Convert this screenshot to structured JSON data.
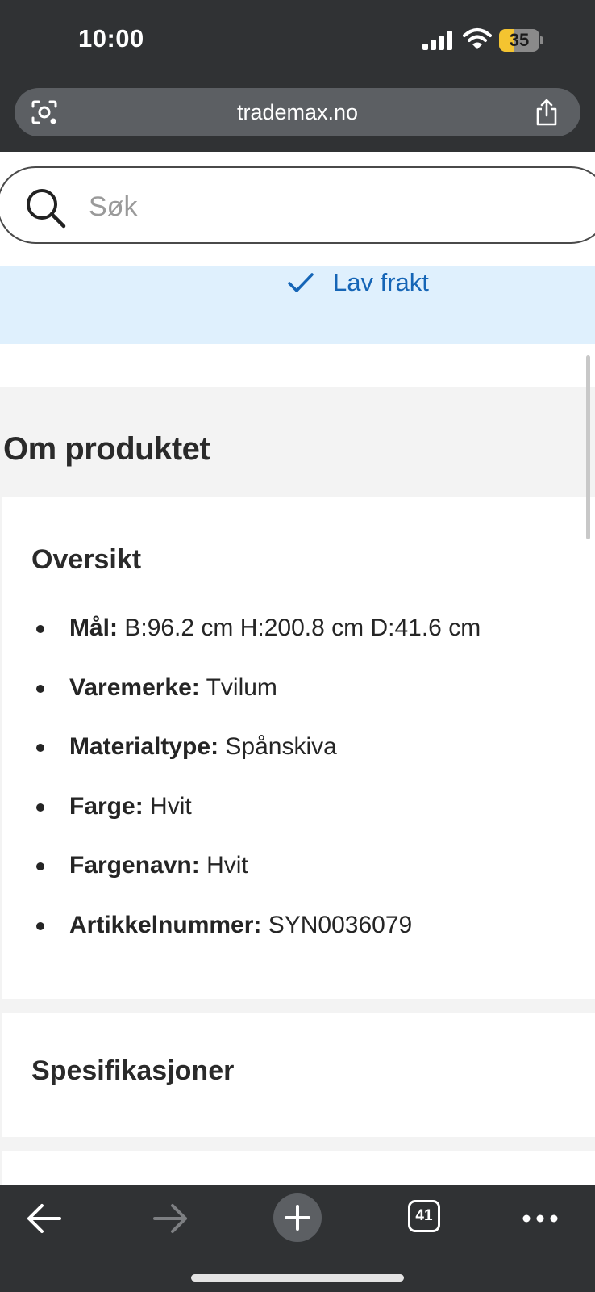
{
  "status_bar": {
    "time": "10:00",
    "battery": "35",
    "battery_fraction": 0.35,
    "icons": [
      "signal-icon",
      "wifi-icon",
      "battery-icon"
    ]
  },
  "browser": {
    "url": "trademax.no",
    "tab_count": "41",
    "icons": [
      "lens-icon",
      "share-icon",
      "back-arrow-icon",
      "forward-arrow-icon",
      "plus-icon",
      "tabs-icon",
      "more-icon"
    ]
  },
  "search": {
    "placeholder": "Søk",
    "value": ""
  },
  "banner": {
    "text": "Lav frakt",
    "icon": "check-icon",
    "color": "#1565b6",
    "background": "#dff0fd"
  },
  "product": {
    "section_title": "Om produktet",
    "overview": {
      "title": "Oversikt",
      "items": [
        {
          "label": "Mål:",
          "value": "B:96.2 cm H:200.8 cm D:41.6 cm"
        },
        {
          "label": "Varemerke:",
          "value": "Tvilum"
        },
        {
          "label": "Materialtype:",
          "value": "Spånskiva"
        },
        {
          "label": "Farge:",
          "value": "Hvit"
        },
        {
          "label": "Fargenavn:",
          "value": "Hvit"
        },
        {
          "label": "Artikkelnummer:",
          "value": "SYN0036079"
        }
      ]
    },
    "specifications": {
      "title": "Spesifikasjoner"
    }
  }
}
